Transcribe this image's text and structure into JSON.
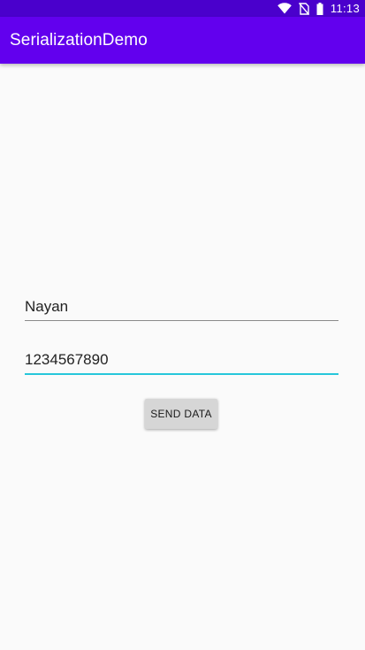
{
  "status_bar": {
    "time": "11:13",
    "icons": [
      "wifi-icon",
      "no-sim-icon",
      "battery-icon"
    ]
  },
  "app_bar": {
    "title": "SerializationDemo",
    "color": "#6200ee"
  },
  "form": {
    "name_value": "Nayan",
    "phone_value": "1234567890",
    "send_button_label": "SEND DATA"
  },
  "colors": {
    "status_bar": "#4a00cc",
    "accent_underline": "#26c6da",
    "background": "#fafafa"
  }
}
